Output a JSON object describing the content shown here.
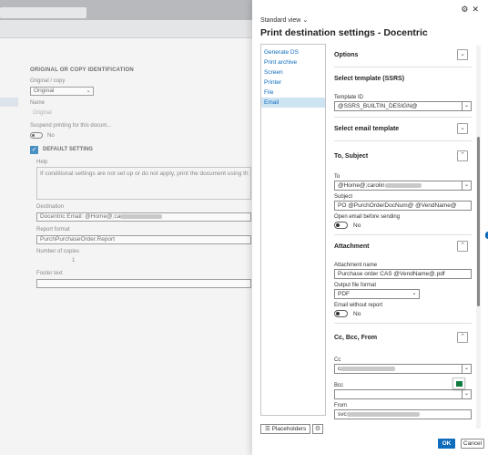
{
  "background": {
    "section_title": "ORIGINAL OR COPY IDENTIFICATION",
    "original_copy_label": "Original / copy",
    "original_copy_value": "Original",
    "name_label": "Name",
    "name_value": "Original",
    "suspend_label": "Suspend printing for this docum...",
    "suspend_value": "No",
    "default_setting": "DEFAULT SETTING",
    "help_label": "Help",
    "help_text": "If conditional settings are not set up or do not apply, print the document using th",
    "destination_label": "Destination",
    "destination_value": "Docentric Email: @Home@;ca",
    "report_format_label": "Report format",
    "report_format_value": "PurchPurchaseOrder.Report",
    "copies_label": "Number of copies",
    "copies_value": "1",
    "footer_label": "Footer text"
  },
  "panel": {
    "views": "Standard view",
    "title": "Print destination settings - Docentric",
    "nav": [
      "Generate DS",
      "Print archive",
      "Screen",
      "Printer",
      "File",
      "Email"
    ],
    "nav_selected_index": 5,
    "sections": {
      "options": "Options",
      "select_template": "Select template (SSRS)",
      "template_id_label": "Template ID",
      "template_id_value": "@SSRS_BUILTIN_DESIGN@",
      "select_email_template": "Select email template",
      "to_subject": "To, Subject",
      "to_label": "To",
      "to_value": "@Home@;carolin",
      "subject_label": "Subject",
      "subject_value": "PO  @PurchOrderDocNum@ @VendName@",
      "open_email_label": "Open email before sending",
      "open_email_value": "No",
      "attachment": "Attachment",
      "attachment_name_label": "Attachment name",
      "attachment_name_value": "Purchase order CAS @VendName@.pdf",
      "output_format_label": "Output file format",
      "output_format_value": "PDF",
      "without_report_label": "Email without report",
      "without_report_value": "No",
      "cc_bcc_from": "Cc, Bcc, From",
      "cc_label": "Cc",
      "cc_value": "c",
      "bcc_label": "Bcc",
      "bcc_value": "",
      "from_label": "From",
      "from_value": "svc"
    },
    "placeholders_button": "Placeholders",
    "ok_button": "OK",
    "cancel_button": "Cancel"
  }
}
